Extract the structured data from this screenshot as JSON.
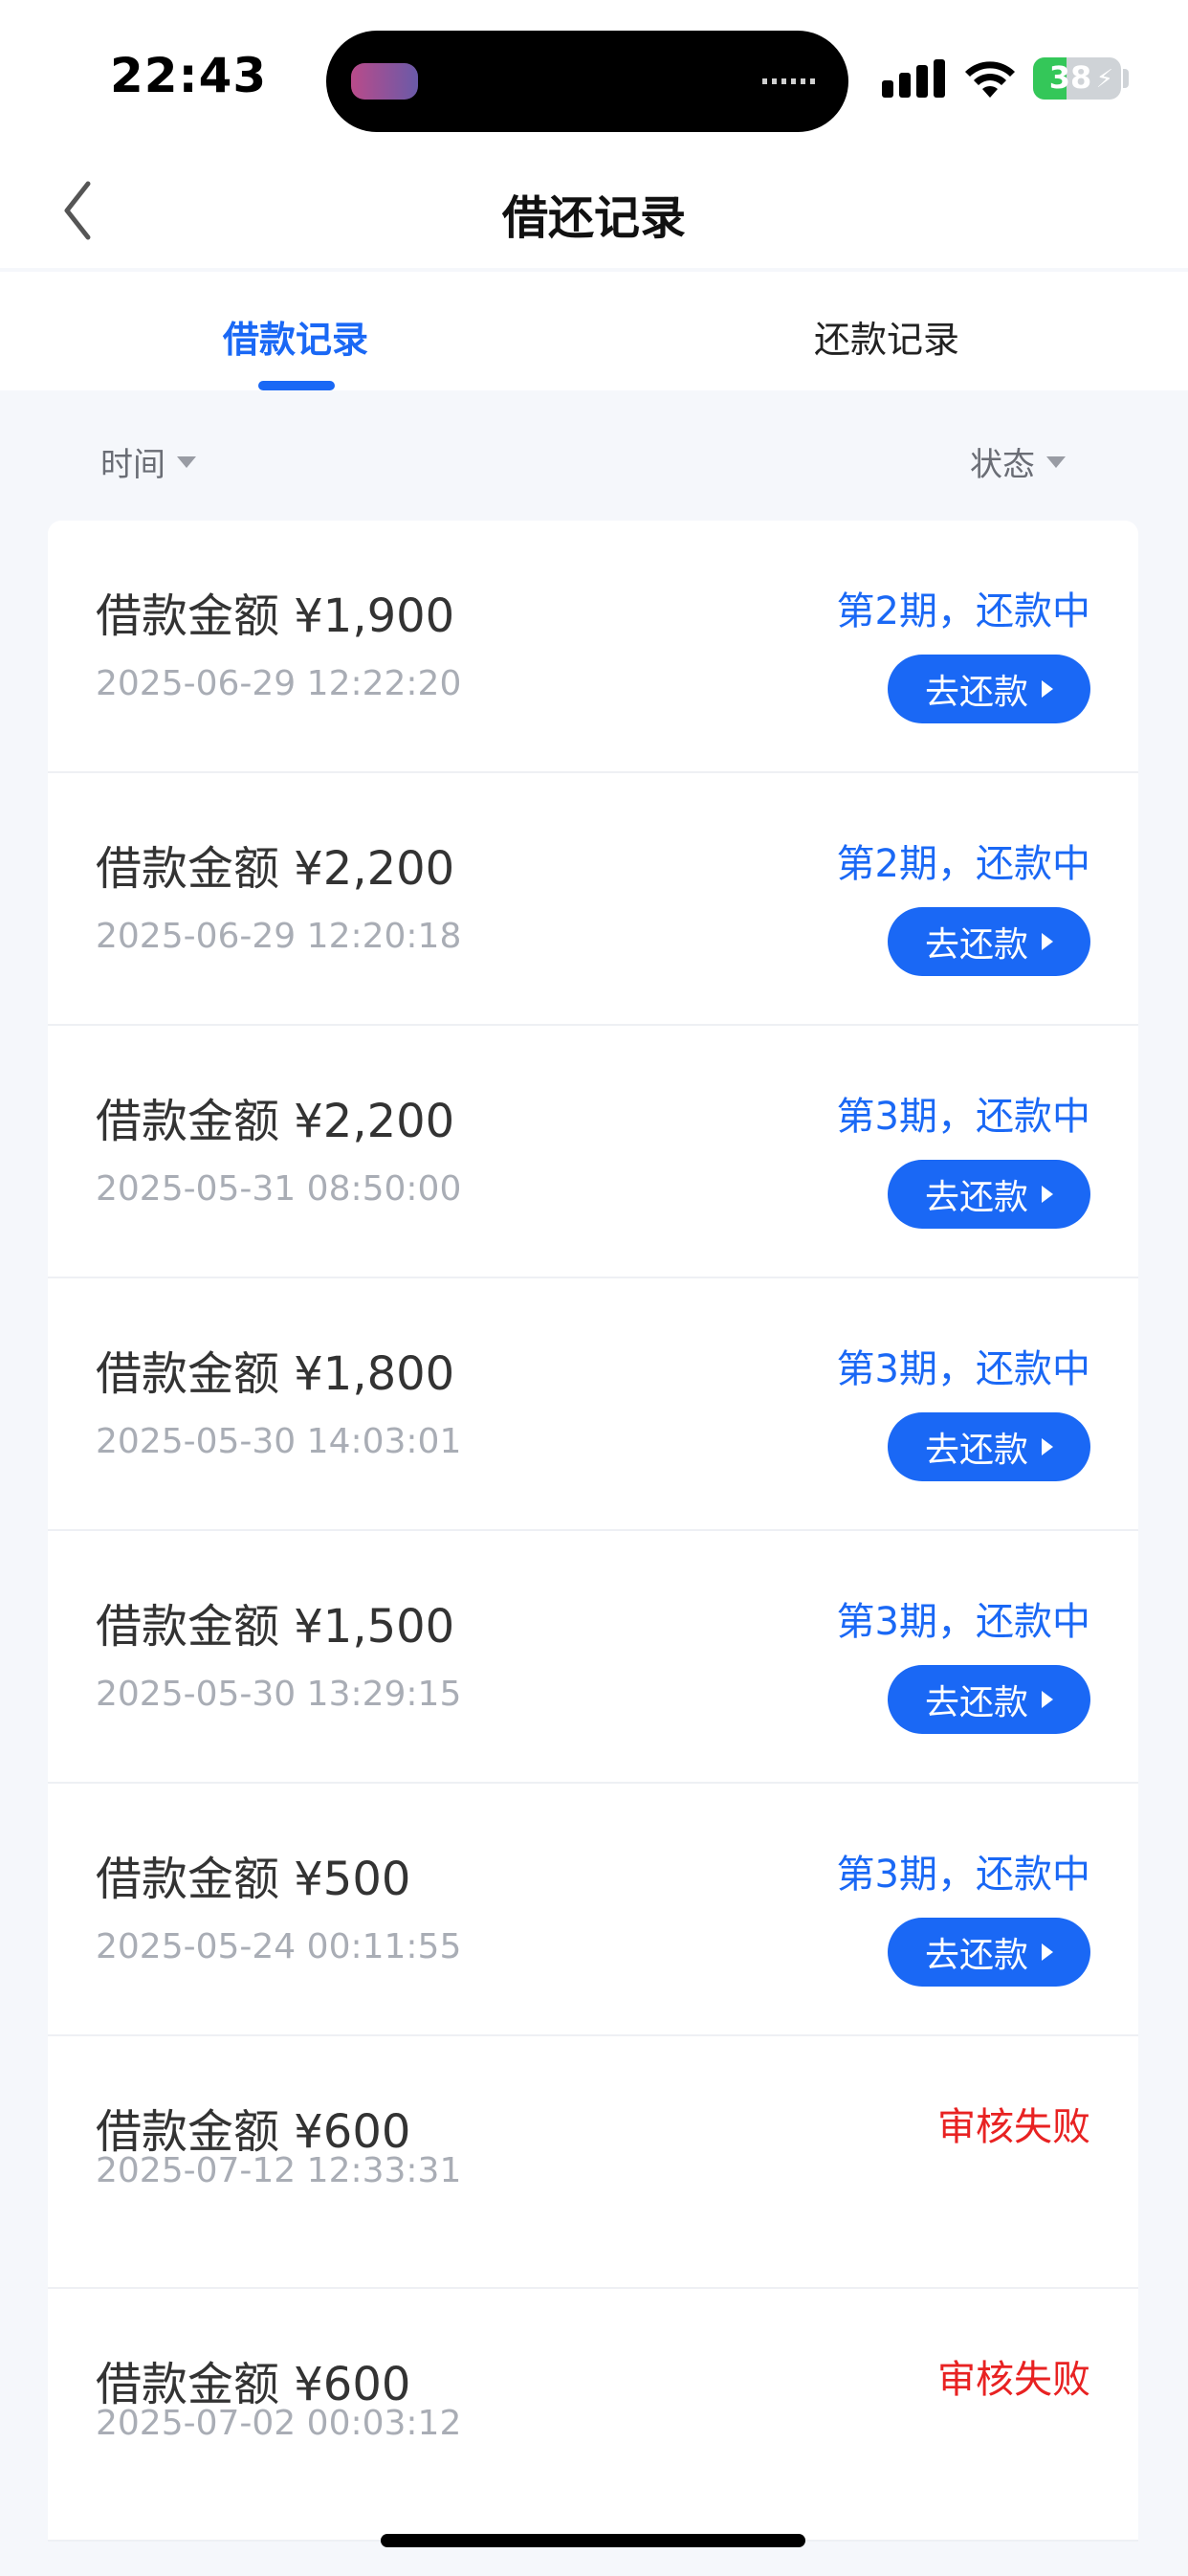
{
  "status_bar": {
    "time": "22:43",
    "battery": "38"
  },
  "header": {
    "title": "借还记录"
  },
  "tabs": [
    {
      "label": "借款记录",
      "active": true
    },
    {
      "label": "还款记录",
      "active": false
    }
  ],
  "filters": {
    "time_label": "时间",
    "status_label": "状态"
  },
  "records": [
    {
      "amount": "借款金额 ¥1,900",
      "date": "2025-06-29 12:22:20",
      "status": "第2期，还款中",
      "button": "去还款"
    },
    {
      "amount": "借款金额 ¥2,200",
      "date": "2025-06-29 12:20:18",
      "status": "第2期，还款中",
      "button": "去还款"
    },
    {
      "amount": "借款金额 ¥2,200",
      "date": "2025-05-31 08:50:00",
      "status": "第3期，还款中",
      "button": "去还款"
    },
    {
      "amount": "借款金额 ¥1,800",
      "date": "2025-05-30 14:03:01",
      "status": "第3期，还款中",
      "button": "去还款"
    },
    {
      "amount": "借款金额 ¥1,500",
      "date": "2025-05-30 13:29:15",
      "status": "第3期，还款中",
      "button": "去还款"
    },
    {
      "amount": "借款金额 ¥500",
      "date": "2025-05-24 00:11:55",
      "status": "第3期，还款中",
      "button": "去还款"
    },
    {
      "amount": "借款金额 ¥600",
      "date": "2025-07-12 12:33:31",
      "status": "审核失败"
    },
    {
      "amount": "借款金额 ¥600",
      "date": "2025-07-02 00:03:12",
      "status": "审核失败"
    }
  ],
  "colors": {
    "accent": "#1a68f5",
    "failed": "#e82222"
  },
  "icons": [
    "back-chevron-icon",
    "caret-down-icon",
    "play-triangle-icon",
    "signal-icon",
    "wifi-icon",
    "battery-icon"
  ]
}
